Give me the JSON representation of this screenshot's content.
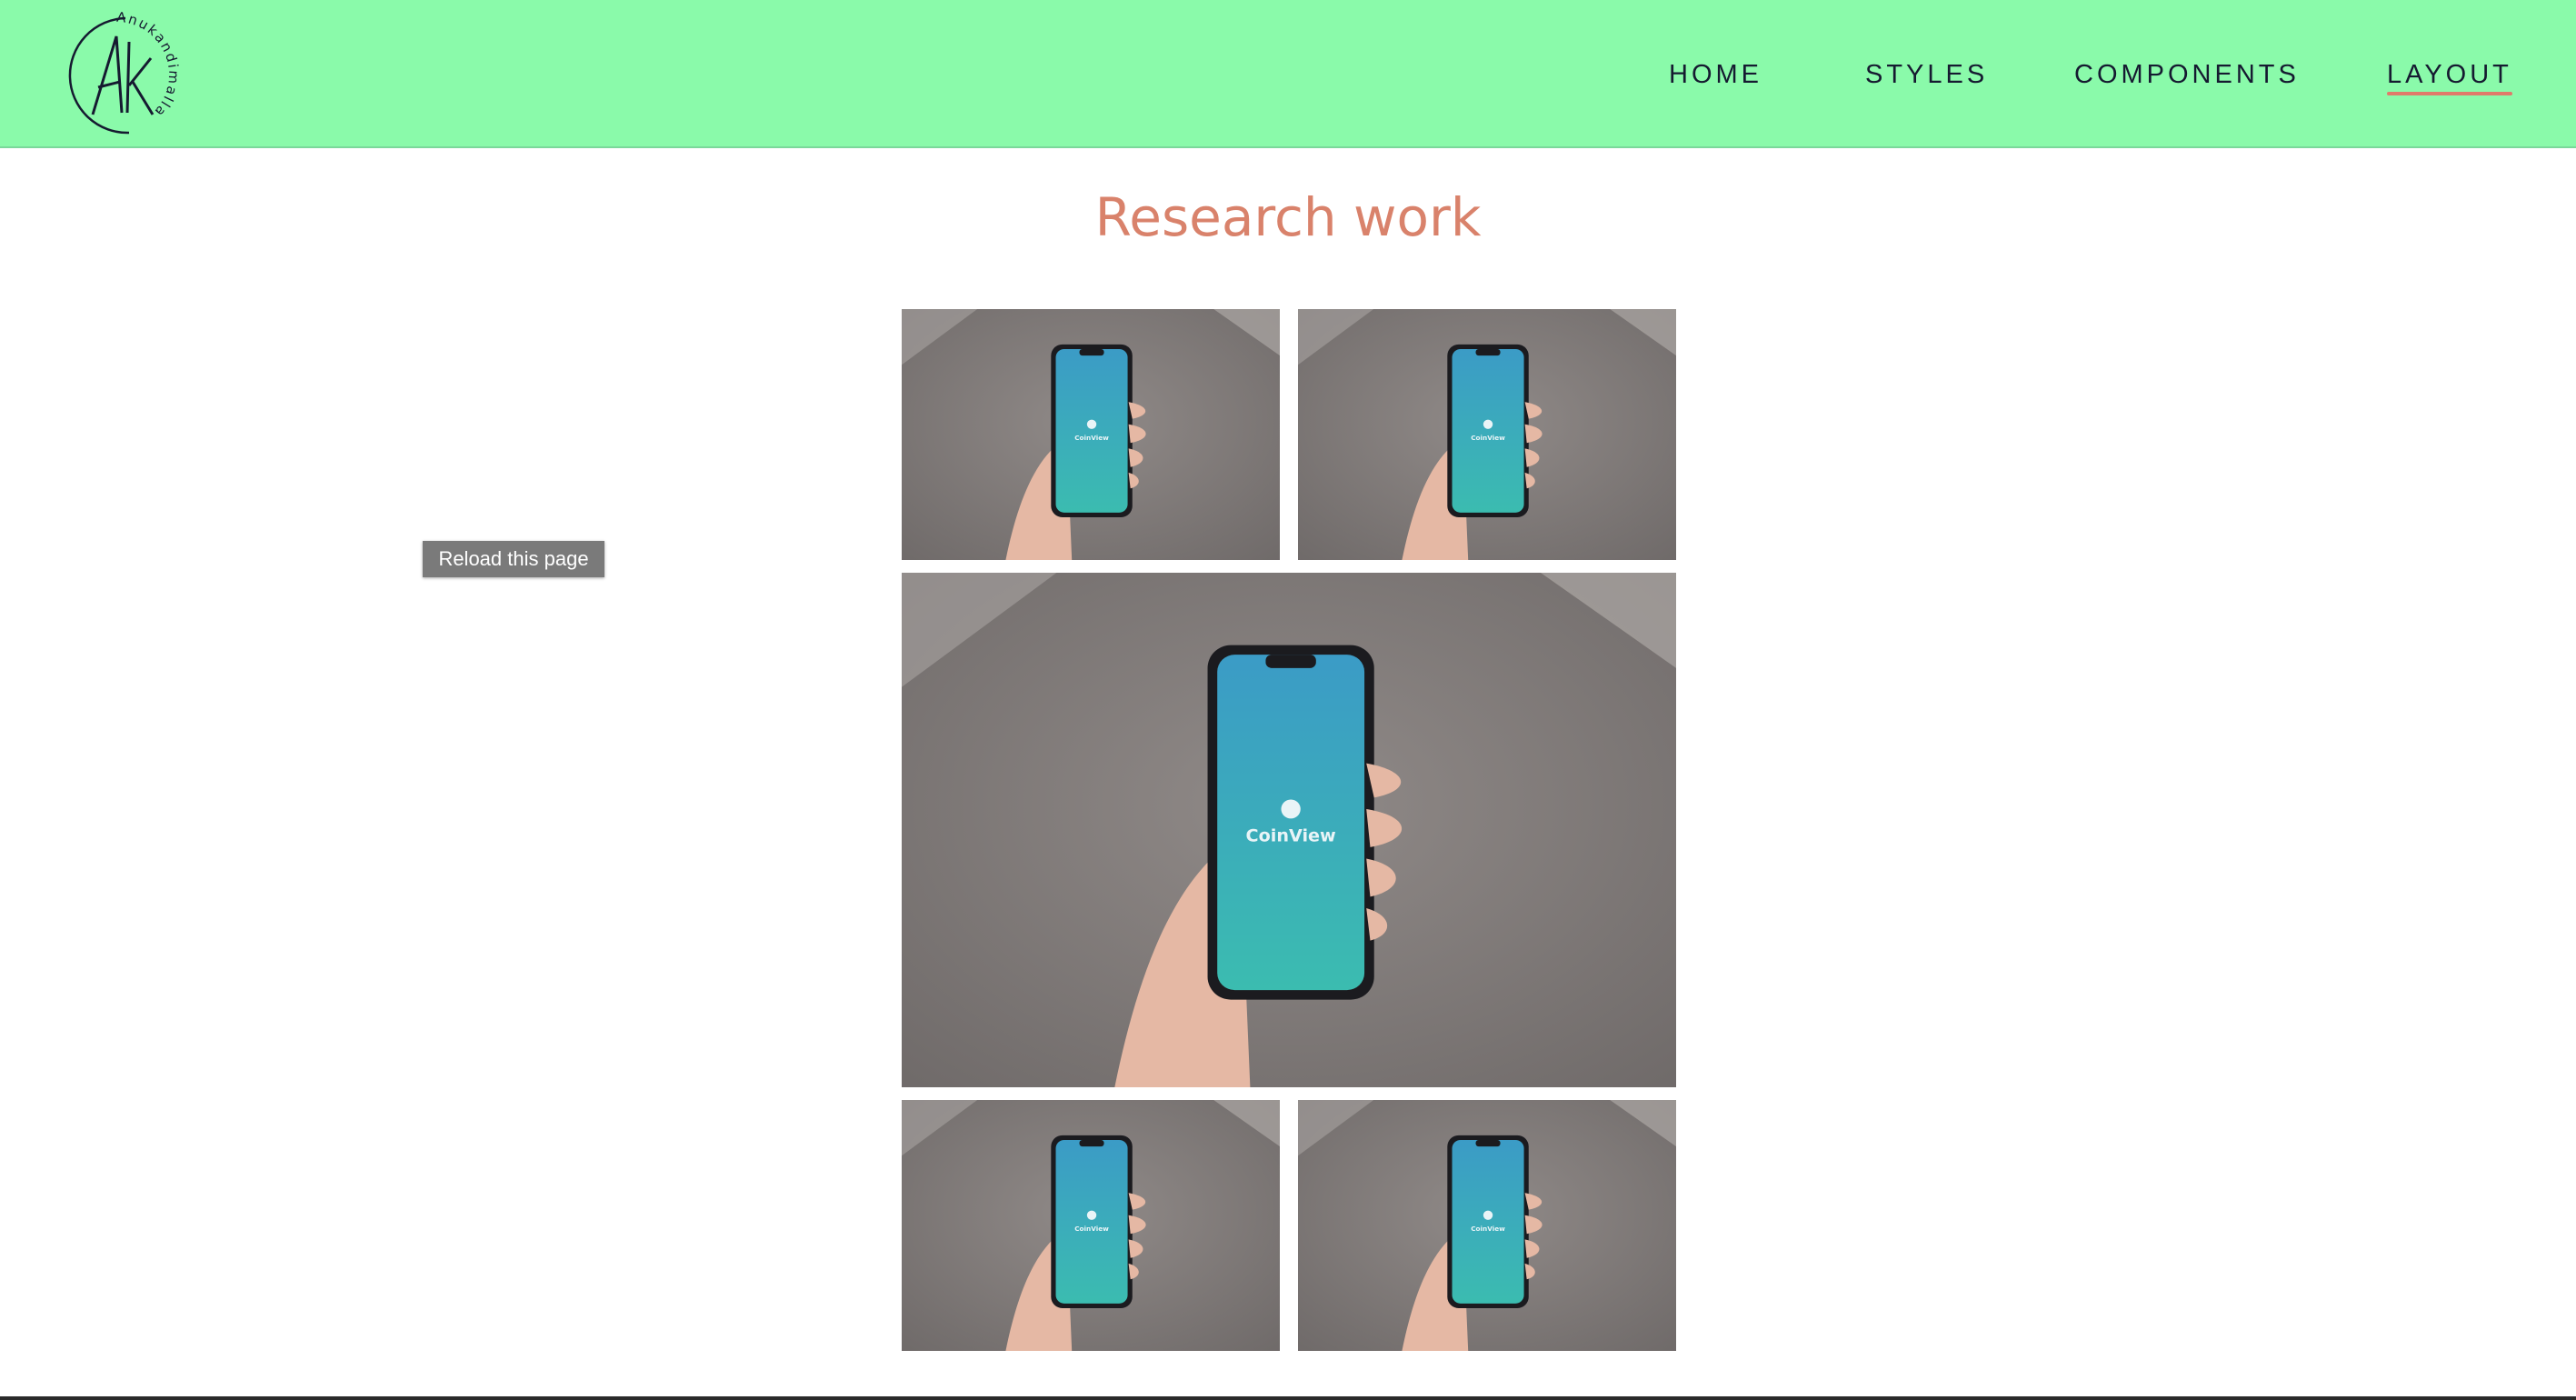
{
  "header": {
    "logo": {
      "monogram": "AK",
      "circular_text": "Anukandimalla",
      "alt": "Anukandimalla logo"
    },
    "nav": [
      {
        "label": "HOME",
        "active": false
      },
      {
        "label": "STYLES",
        "active": false
      },
      {
        "label": "COMPONENTS",
        "active": false
      },
      {
        "label": "LAYOUT",
        "active": true
      }
    ],
    "colors": {
      "background": "#8afaaa",
      "nav_text": "#151a30",
      "active_underline": "#e07a6a"
    }
  },
  "main": {
    "title": "Research work",
    "title_color": "#d9826b",
    "gallery": {
      "image_alt": "Hand holding a phone showing the CoinView app",
      "app_name": "CoinView",
      "count": 5
    }
  },
  "tooltip": {
    "text": "Reload this page"
  }
}
